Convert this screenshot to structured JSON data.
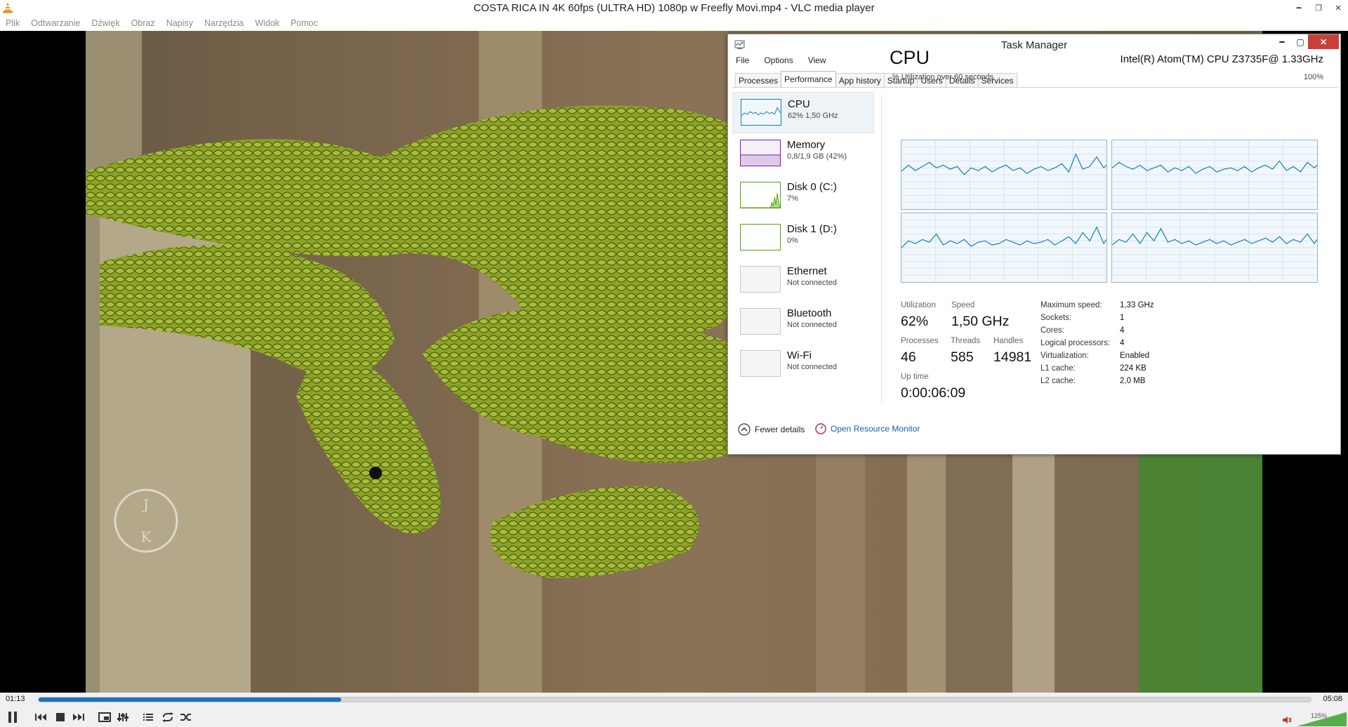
{
  "vlc": {
    "title": "COSTA RICA IN 4K 60fps (ULTRA HD) 1080p w  Freefly Movi.mp4 - VLC media player",
    "menu": [
      "Plik",
      "Odtwarzanie",
      "Dźwięk",
      "Obraz",
      "Napisy",
      "Narzędzia",
      "Widok",
      "Pomoc"
    ],
    "time_current": "01:13",
    "time_total": "05:08",
    "progress": 0.238,
    "volume_label": "125%",
    "volume": 1.25,
    "accent_color": "#1f6fbf",
    "video": {
      "watermark_letters": [
        "J",
        "K"
      ]
    }
  },
  "taskmanager": {
    "title": "Task Manager",
    "menu": [
      "File",
      "Options",
      "View"
    ],
    "tabs": [
      "Processes",
      "Performance",
      "App history",
      "Startup",
      "Users",
      "Details",
      "Services"
    ],
    "selected_tab": "Performance",
    "side_items": [
      {
        "name": "CPU",
        "sub": "62% 1,50 GHz",
        "color": "#117dbb"
      },
      {
        "name": "Memory",
        "sub": "0,8/1,9 GB (42%)",
        "color": "#8b12ae"
      },
      {
        "name": "Disk 0 (C:)",
        "sub": "7%",
        "color": "#4da60c"
      },
      {
        "name": "Disk 1 (D:)",
        "sub": "0%",
        "color": "#4da60c"
      },
      {
        "name": "Ethernet",
        "sub": "Not connected",
        "color": "#a8a8a8"
      },
      {
        "name": "Bluetooth",
        "sub": "Not connected",
        "color": "#a8a8a8"
      },
      {
        "name": "Wi-Fi",
        "sub": "Not connected",
        "color": "#a8a8a8"
      }
    ],
    "cpu": {
      "heading": "CPU",
      "model": "Intel(R) Atom(TM) CPU Z3735F@ 1.33GHz",
      "util_label": "% Utilization over 60 seconds",
      "util_max": "100%",
      "stats": {
        "utilization_label": "Utilization",
        "utilization": "62%",
        "speed_label": "Speed",
        "speed": "1,50 GHz",
        "processes_label": "Processes",
        "processes": "46",
        "threads_label": "Threads",
        "threads": "585",
        "handles_label": "Handles",
        "handles": "14981",
        "uptime_label": "Up time",
        "uptime": "0:00:06:09"
      },
      "specs": [
        {
          "k": "Maximum speed:",
          "v": "1,33 GHz"
        },
        {
          "k": "Sockets:",
          "v": "1"
        },
        {
          "k": "Cores:",
          "v": "4"
        },
        {
          "k": "Logical processors:",
          "v": "4"
        },
        {
          "k": "Virtualization:",
          "v": "Enabled"
        },
        {
          "k": "L1 cache:",
          "v": "224 KB"
        },
        {
          "k": "L2 cache:",
          "v": "2,0 MB"
        }
      ]
    },
    "footer": {
      "fewer": "Fewer details",
      "resmon": "Open Resource Monitor"
    }
  }
}
